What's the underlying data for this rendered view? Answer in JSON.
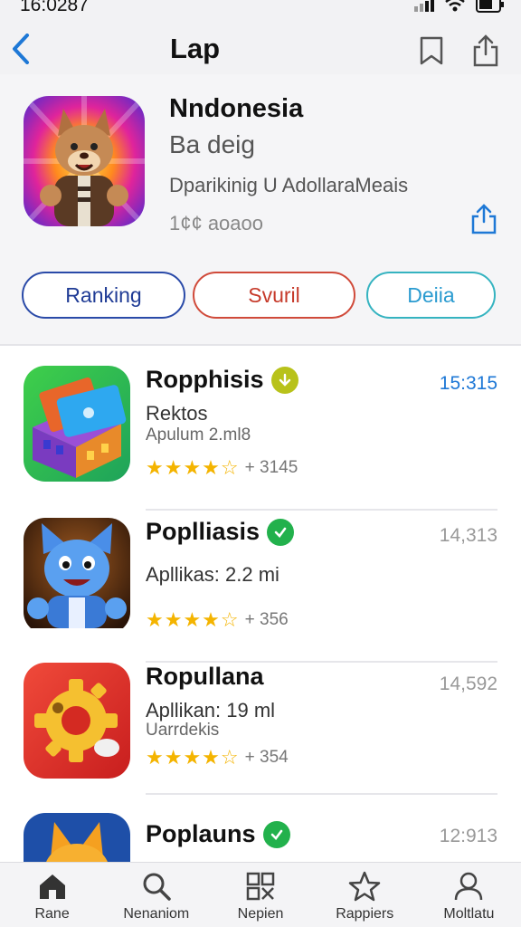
{
  "status_bar": {
    "time": "16:0287"
  },
  "header": {
    "title": "Lap"
  },
  "hero": {
    "title": "Nndonesia",
    "subtitle": "Ba deig",
    "description": "Dparikinig U AdollaraMeais",
    "meta": "1¢¢ aoaoo"
  },
  "pills": [
    {
      "label": "Ranking"
    },
    {
      "label": "Svuril"
    },
    {
      "label": "Deiia"
    }
  ],
  "apps": [
    {
      "name": "Ropphisis",
      "line2": "Rektos",
      "line3": "Apulum 2.ml8",
      "stars": "★★★★☆",
      "rating_count": "+ 3145",
      "time": "15:315",
      "badge_color": "#b8c21a"
    },
    {
      "name": "Poplliasis",
      "line2": "Apllikas: 2.2 mi",
      "line3": "",
      "stars": "★★★★☆",
      "rating_count": "+ 356",
      "time": "14,313",
      "badge_color": "#22b14c"
    },
    {
      "name": "Ropullana",
      "line2": "Apllikan: 19 ml",
      "line3": "Uarrdekis",
      "stars": "★★★★☆",
      "rating_count": "+ 354",
      "time": "14,592",
      "badge_color": ""
    },
    {
      "name": "Poplauns",
      "line2": "",
      "line3": "",
      "stars": "",
      "rating_count": "",
      "time": "12:913",
      "badge_color": "#22b14c"
    }
  ],
  "tabs": [
    {
      "label": "Rane",
      "icon": "home-icon"
    },
    {
      "label": "Nenaniom",
      "icon": "search-icon"
    },
    {
      "label": "Nepien",
      "icon": "grid-icon"
    },
    {
      "label": "Rappiers",
      "icon": "star-icon"
    },
    {
      "label": "Moltlatu",
      "icon": "person-icon"
    }
  ],
  "colors": {
    "accent": "#1e78d6",
    "stars": "#f4b400"
  }
}
